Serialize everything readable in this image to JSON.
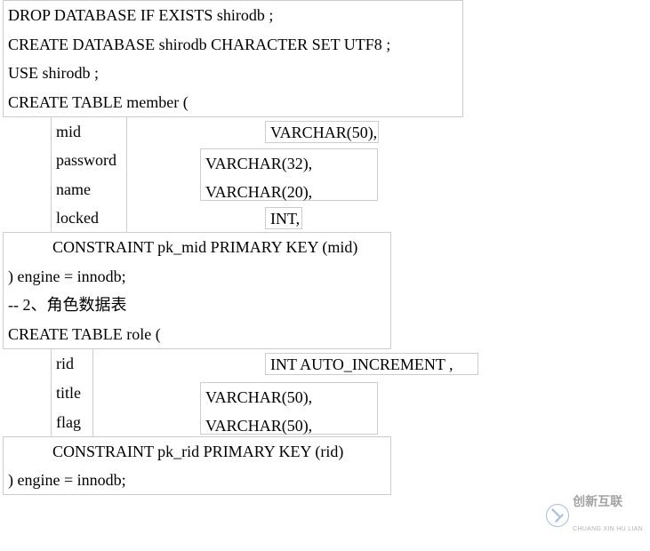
{
  "sql": {
    "line1": "DROP DATABASE IF EXISTS shirodb ;",
    "line2": "CREATE DATABASE shirodb CHARACTER SET UTF8 ;",
    "line3": "USE shirodb ;",
    "line4": "CREATE TABLE member (",
    "member_fields": [
      {
        "name": "mid",
        "type": "VARCHAR(50),"
      },
      {
        "name": "password",
        "type": "VARCHAR(32),"
      },
      {
        "name": "name",
        "type": "VARCHAR(20),"
      },
      {
        "name": "locked",
        "type": "INT,"
      }
    ],
    "member_pk": "CONSTRAINT pk_mid PRIMARY KEY (mid)",
    "member_engine": ") engine = innodb;",
    "comment_role": "-- 2、角色数据表",
    "create_role": "CREATE TABLE role (",
    "role_fields": [
      {
        "name": "rid",
        "type": "INT   AUTO_INCREMENT ,"
      },
      {
        "name": "title",
        "type": "VARCHAR(50),"
      },
      {
        "name": "flag",
        "type": "VARCHAR(50),"
      }
    ],
    "role_pk": "CONSTRAINT pk_rid PRIMARY KEY (rid)",
    "role_engine": ") engine = innodb;"
  },
  "watermark": {
    "cn": "创新互联",
    "en": "CHUANG XIN HU LIAN"
  }
}
